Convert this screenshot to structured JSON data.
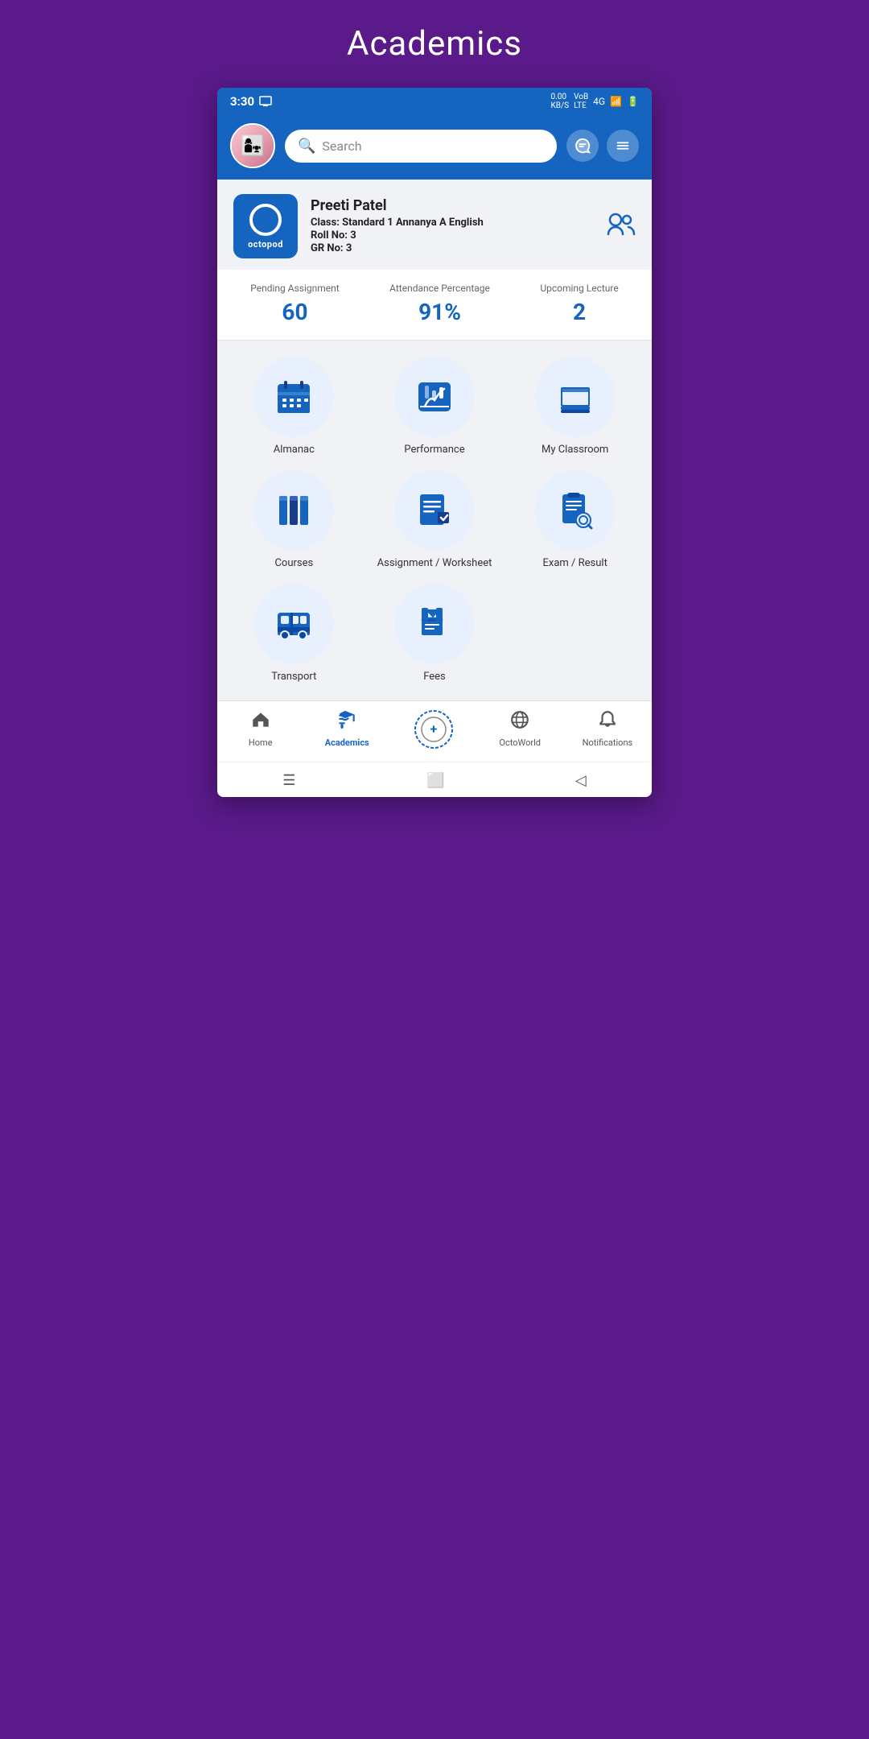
{
  "page": {
    "title": "Academics",
    "bg_color": "#5a1a8a"
  },
  "status_bar": {
    "time": "3:30",
    "network": "4G",
    "battery": "⑥"
  },
  "header": {
    "search_placeholder": "Search",
    "search_icon": "🔍"
  },
  "profile": {
    "name": "Preeti Patel",
    "class_label": "Class:",
    "class_value": "Standard 1 Annanya A English",
    "roll_label": "Roll No:",
    "roll_value": "3",
    "gr_label": "GR No:",
    "gr_value": "3",
    "logo_text": "octopod"
  },
  "stats": [
    {
      "label": "Pending Assignment",
      "value": "60"
    },
    {
      "label": "Attendance Percentage",
      "value": "91%"
    },
    {
      "label": "Upcoming Lecture",
      "value": "2"
    }
  ],
  "menu_items": [
    {
      "id": "almanac",
      "label": "Almanac",
      "icon": "almanac"
    },
    {
      "id": "performance",
      "label": "Performance",
      "icon": "performance"
    },
    {
      "id": "my-classroom",
      "label": "My Classroom",
      "icon": "classroom"
    },
    {
      "id": "courses",
      "label": "Courses",
      "icon": "courses"
    },
    {
      "id": "assignment-worksheet",
      "label": "Assignment / Worksheet",
      "icon": "assignment"
    },
    {
      "id": "exam-result",
      "label": "Exam / Result",
      "icon": "exam"
    },
    {
      "id": "transport",
      "label": "Transport",
      "icon": "transport"
    },
    {
      "id": "fees",
      "label": "Fees",
      "icon": "fees"
    }
  ],
  "bottom_nav": [
    {
      "id": "home",
      "label": "Home",
      "icon": "home",
      "active": false
    },
    {
      "id": "academics",
      "label": "Academics",
      "icon": "academics",
      "active": true
    },
    {
      "id": "octoplus",
      "label": "",
      "icon": "octoplus",
      "active": false
    },
    {
      "id": "octoworld",
      "label": "OctoWorld",
      "icon": "globe",
      "active": false
    },
    {
      "id": "notifications",
      "label": "Notifications",
      "icon": "bell",
      "active": false
    }
  ]
}
